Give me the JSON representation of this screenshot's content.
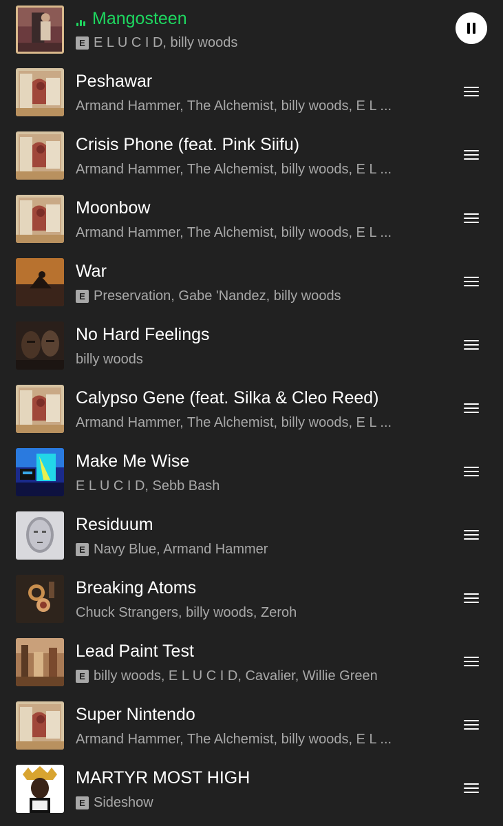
{
  "colors": {
    "background": "#212121",
    "now_playing": "#1ed760",
    "title": "#ffffff",
    "subtitle": "#a8a8a8"
  },
  "queue": [
    {
      "title": "Mangosteen",
      "artists": "E L U C I D, billy woods",
      "explicit": true,
      "now_playing": true,
      "art": "art-a"
    },
    {
      "title": "Peshawar",
      "artists": "Armand Hammer, The Alchemist, billy woods, E L ...",
      "explicit": false,
      "art": "art-b"
    },
    {
      "title": "Crisis Phone (feat. Pink Siifu)",
      "artists": "Armand Hammer, The Alchemist, billy woods, E L ...",
      "explicit": false,
      "art": "art-b"
    },
    {
      "title": "Moonbow",
      "artists": "Armand Hammer, The Alchemist, billy woods, E L ...",
      "explicit": false,
      "art": "art-b"
    },
    {
      "title": "War",
      "artists": "Preservation, Gabe 'Nandez, billy woods",
      "explicit": true,
      "art": "art-c"
    },
    {
      "title": "No Hard Feelings",
      "artists": "billy woods",
      "explicit": false,
      "art": "art-d"
    },
    {
      "title": "Calypso Gene (feat. Silka & Cleo Reed)",
      "artists": "Armand Hammer, The Alchemist, billy woods, E L ...",
      "explicit": false,
      "art": "art-b"
    },
    {
      "title": "Make Me Wise",
      "artists": "E L U C I D, Sebb Bash",
      "explicit": false,
      "art": "art-e"
    },
    {
      "title": "Residuum",
      "artists": "Navy Blue, Armand Hammer",
      "explicit": true,
      "art": "art-f"
    },
    {
      "title": "Breaking Atoms",
      "artists": "Chuck Strangers, billy woods, Zeroh",
      "explicit": false,
      "art": "art-g"
    },
    {
      "title": "Lead Paint Test",
      "artists": "billy woods, E L U C I D, Cavalier, Willie Green",
      "explicit": true,
      "art": "art-h"
    },
    {
      "title": "Super Nintendo",
      "artists": "Armand Hammer, The Alchemist, billy woods, E L ...",
      "explicit": false,
      "art": "art-b"
    },
    {
      "title": "MARTYR MOST HIGH",
      "artists": "Sideshow",
      "explicit": true,
      "art": "art-i"
    }
  ],
  "labels": {
    "explicit_badge": "E"
  },
  "icons": {
    "pause": "pause-icon",
    "drag_handle": "drag-handle-icon",
    "equalizer": "equalizer-icon"
  }
}
